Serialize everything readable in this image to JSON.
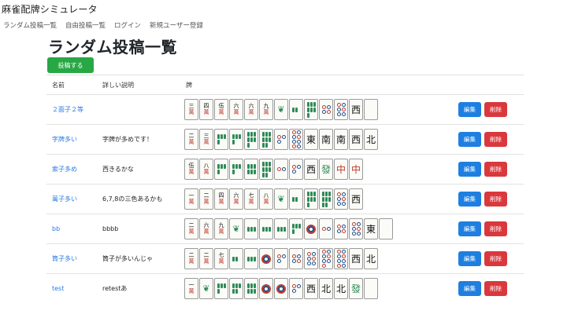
{
  "site": {
    "title": "麻雀配牌シミュレータ",
    "nav": [
      "ランダム投稿一覧",
      "自由投稿一覧",
      "ログイン",
      "新規ユーザー登録"
    ]
  },
  "page": {
    "title": "ランダム投稿一覧",
    "post_button": "投稿する"
  },
  "table": {
    "headers": [
      "名前",
      "詳しい説明",
      "牌"
    ],
    "edit_label": "編集",
    "delete_label": "削除",
    "rows": [
      {
        "name": "２面子２等",
        "desc": "",
        "tiles": [
          "m3",
          "m4",
          "m5",
          "m6",
          "m6",
          "m9",
          "s1",
          "s2",
          "s7",
          "p4",
          "p6",
          "西",
          "白"
        ]
      },
      {
        "name": "字牌多い",
        "desc": "字牌が多めです！",
        "tiles": [
          "m2",
          "m3",
          "s4",
          "s4",
          "s7",
          "s8",
          "p3",
          "p8",
          "東",
          "南",
          "南",
          "西",
          "北"
        ]
      },
      {
        "name": "索子多め",
        "desc": "西きるかな",
        "tiles": [
          "m5",
          "m8",
          "s4",
          "s4",
          "s6",
          "s8",
          "p2",
          "p3",
          "西",
          "發",
          "中",
          "中"
        ]
      },
      {
        "name": "萬子多い",
        "desc": "6,7,8の三色あるかも",
        "tiles": [
          "m1",
          "m2",
          "m4",
          "m6",
          "m7",
          "m8",
          "s1",
          "s2",
          "s7",
          "s8",
          "p6",
          "西"
        ]
      },
      {
        "name": "bb",
        "desc": "bbbb",
        "tiles": [
          "m2",
          "m6",
          "m9",
          "s1",
          "s3",
          "s3",
          "s3",
          "s4",
          "p1",
          "p2",
          "p4",
          "p6",
          "東",
          "白"
        ]
      },
      {
        "name": "筒子多い",
        "desc": "筒子が多いんじゃ",
        "tiles": [
          "m2",
          "m2",
          "m7",
          "s2",
          "s3",
          "p1",
          "p3",
          "p4",
          "p6",
          "p7",
          "p9",
          "西",
          "北"
        ]
      },
      {
        "name": "test",
        "desc": "retestあ",
        "tiles": [
          "m1",
          "s1",
          "s4",
          "s5",
          "s6",
          "p1",
          "p1",
          "p3",
          "西",
          "北",
          "北",
          "發",
          "白"
        ]
      }
    ]
  }
}
